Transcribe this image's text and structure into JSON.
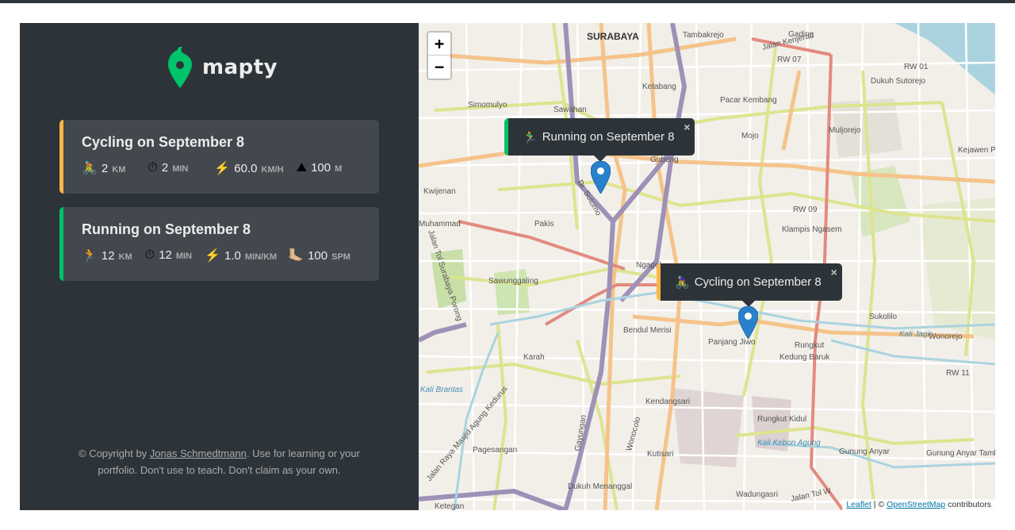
{
  "app": {
    "name": "mapty",
    "colors": {
      "sidebar_bg": "#2d3439",
      "card_bg": "#42484d",
      "cycling_accent": "#ffb545",
      "running_accent": "#00c46a",
      "map_bg": "#f2efe9"
    }
  },
  "workouts": [
    {
      "type": "cycling",
      "title": "Cycling on September 8",
      "details": [
        {
          "icon": "🚴",
          "icon_name": "bicycle-icon",
          "value": "2",
          "unit": "km"
        },
        {
          "icon": "⏱",
          "icon_name": "stopwatch-icon",
          "value": "2",
          "unit": "min"
        },
        {
          "icon": "⚡️",
          "icon_name": "lightning-icon",
          "value": "60.0",
          "unit": "km/h"
        },
        {
          "icon": "⛰",
          "icon_name": "mountain-icon",
          "value": "100",
          "unit": "m"
        }
      ]
    },
    {
      "type": "running",
      "title": "Running on September 8",
      "details": [
        {
          "icon": "🏃",
          "icon_name": "runner-icon",
          "value": "12",
          "unit": "km"
        },
        {
          "icon": "⏱",
          "icon_name": "stopwatch-icon",
          "value": "12",
          "unit": "min"
        },
        {
          "icon": "⚡️",
          "icon_name": "lightning-icon",
          "value": "1.0",
          "unit": "min/km"
        },
        {
          "icon": "🦶🏼",
          "icon_name": "footprint-icon",
          "value": "100",
          "unit": "spm"
        }
      ]
    }
  ],
  "copyright": {
    "prefix": "© Copyright by ",
    "author": "Jonas Schmedtmann",
    "suffix": ". Use for learning or your portfolio. Don't use to teach. Don't claim as your own."
  },
  "map": {
    "zoom_in": "+",
    "zoom_out": "−",
    "popups": [
      {
        "type": "running",
        "icon": "🏃‍♂️",
        "text": "Running on September 8",
        "close": "×"
      },
      {
        "type": "cycling",
        "icon": "🚴‍♀️",
        "text": "Cycling on September 8",
        "close": "×"
      }
    ],
    "attribution": {
      "leaflet": "Leaflet",
      "sep": " | © ",
      "osm": "OpenStreetMap",
      "suffix": " contributors"
    },
    "labels": [
      "SURABAYA",
      "Tambakrejo",
      "Gading",
      "Jalan Kenjeran",
      "RW 07",
      "RW 01",
      "Dukuh Sutorejo",
      "Ketabang",
      "Pacar Kembang",
      "Simomulyo",
      "Sawahan",
      "Gubeng",
      "Mojo",
      "Muljorejo",
      "Kejawen Putih Tamb",
      "Kwijenan",
      "Dr. Sutomo",
      "RW 09",
      "Klampis Ngasem",
      "Pakis",
      "Muhammad",
      "Jalan Tol Surabaya Porong",
      "Ngagel",
      "Sawunggaling",
      "Bendul Merisi",
      "Panjang Jiwo",
      "Sukolilo",
      "Kali Jagir",
      "Wonorejo",
      "Rungkut",
      "Kedung Baruk",
      "RW 11",
      "Karah",
      "Kali Brantas",
      "Kendangsari",
      "Rungkut Kidul",
      "Kali Kebon Agung",
      "Gayungan",
      "Wonocolo",
      "Kutisari",
      "Pagesangan",
      "Jalan Raya Masjid Agung Kedurus",
      "Gunung Anyar",
      "Gunung Anyar Tambak",
      "Dukuh Menanggal",
      "Ketegan",
      "Wadungasri",
      "Jalan Tol W"
    ]
  }
}
